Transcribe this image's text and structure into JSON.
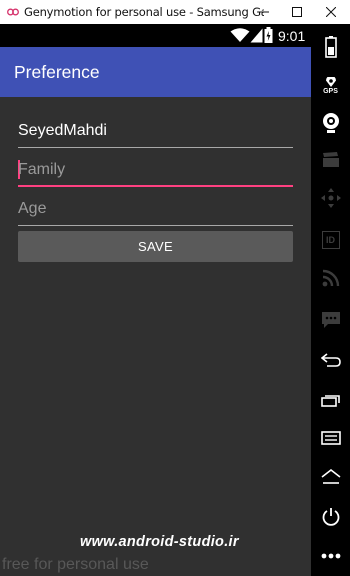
{
  "window": {
    "title": "Genymotion for personal use - Samsung Galaxy S...",
    "minimize_label": "—",
    "maximize_label": "☐",
    "close_label": "✕"
  },
  "statusbar": {
    "time": "9:01"
  },
  "appbar": {
    "title": "Preference"
  },
  "form": {
    "name_value": "SeyedMahdi",
    "family_placeholder": "Family",
    "age_placeholder": "Age",
    "save_label": "SAVE"
  },
  "watermarks": {
    "site": "www.android-studio.ir",
    "genymotion": "free for personal use"
  },
  "sidebar": {
    "gps_label": "GPS",
    "id_label": "ID"
  },
  "colors": {
    "appbar": "#3f51b5",
    "accent": "#ff4081",
    "background": "#303030",
    "button": "#5a5a5a"
  }
}
